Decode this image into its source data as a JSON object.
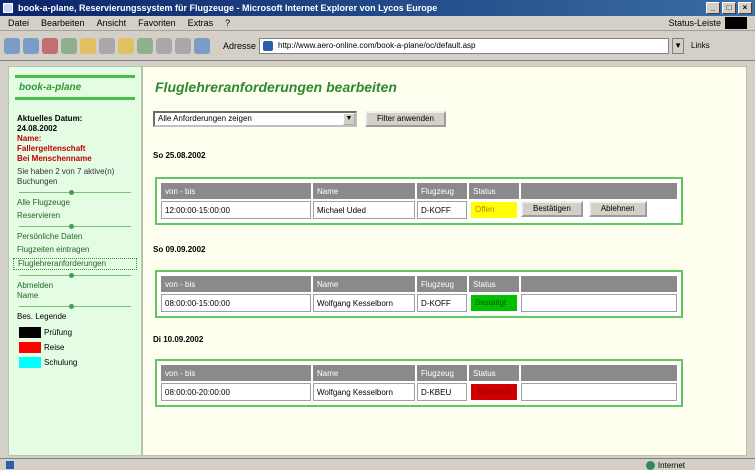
{
  "window": {
    "title": "book-a-plane, Reservierungssystem für Flugzeuge - Microsoft Internet Explorer von Lycos Europe",
    "controls": [
      "_",
      "□",
      "×"
    ]
  },
  "menu": {
    "items": [
      "Datei",
      "Bearbeiten",
      "Ansicht",
      "Favoriten",
      "Extras",
      "?"
    ],
    "right_label": "Status-Leiste"
  },
  "toolbar": {
    "address_label": "Adresse",
    "address_value": "http://www.aero-online.com/book-a-plane/oc/default.asp",
    "links_label": "Links"
  },
  "nav": {
    "logo": "book-a-plane",
    "current_date_label": "Aktuelles Datum:",
    "current_date": "24.08.2002",
    "name_label": "Name:",
    "name_value": "Fallergeltenschaft",
    "role_label": "Bei Menschenname",
    "requests_info": "Sie haben 2 von 7 aktive(n) Buchungen",
    "links1": [
      "Alle Flugzeuge",
      "Reservieren"
    ],
    "links2": [
      "Persönliche Daten",
      "Flugzeiten eintragen",
      "Fluglehreranforderungen"
    ],
    "links3": [
      "Abmelden",
      "Name"
    ],
    "legend_title": "Bes. Legende",
    "legend": [
      {
        "label": "Prüfung",
        "color": "#000000"
      },
      {
        "label": "Reise",
        "color": "#ff0000"
      },
      {
        "label": "Schulung",
        "color": "#00ffff"
      }
    ]
  },
  "main": {
    "title": "Fluglehreranforderungen bearbeiten",
    "filter_select": "Alle Anforderungen zeigen",
    "filter_button": "Filter anwenden",
    "columns": [
      "von - bis",
      "Name",
      "Flugzeug",
      "Status"
    ],
    "days": [
      {
        "heading": "So 25.08.2002",
        "rows": [
          {
            "time": "12:00:00-15:00:00",
            "name": "Michael Uded",
            "plane": "D-KOFF",
            "status": "Offen",
            "status_kind": "offen"
          }
        ],
        "actions": [
          "Bestätigen",
          "Ablehnen"
        ]
      },
      {
        "heading": "So 09.09.2002",
        "rows": [
          {
            "time": "08:00:00-15:00:00",
            "name": "Wolfgang Kesselborn",
            "plane": "D-KOFF",
            "status": "Bestätigt",
            "status_kind": "bestaetigt"
          }
        ],
        "actions": []
      },
      {
        "heading": "Di 10.09.2002",
        "rows": [
          {
            "time": "08:00:00-20:00:00",
            "name": "Wolfgang Kesselborn",
            "plane": "D-KBEU",
            "status": "Abgelehnt",
            "status_kind": "abgelehnt"
          }
        ],
        "actions": []
      }
    ]
  },
  "status": {
    "zone": "Internet"
  }
}
